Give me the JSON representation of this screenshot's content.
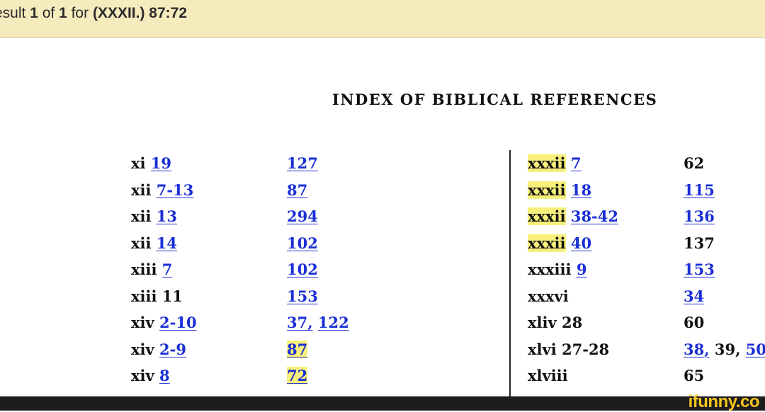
{
  "result_bar": {
    "prefix": "esult ",
    "current": "1",
    "of": " of ",
    "total": "1",
    "for": " for ",
    "query": "(XXXII.) 87:72"
  },
  "title": "INDEX OF BIBLICAL REFERENCES",
  "left_rows": [
    {
      "chapter": "xi",
      "verse": "19",
      "verse_link": true,
      "pages": [
        {
          "text": "127",
          "link": true
        }
      ]
    },
    {
      "chapter": "xii",
      "verse": "7-13",
      "verse_link": true,
      "pages": [
        {
          "text": "87",
          "link": true
        }
      ]
    },
    {
      "chapter": "xii",
      "verse": "13",
      "verse_link": true,
      "pages": [
        {
          "text": "294",
          "link": true
        }
      ]
    },
    {
      "chapter": "xii",
      "verse": "14",
      "verse_link": true,
      "pages": [
        {
          "text": "102",
          "link": true
        }
      ]
    },
    {
      "chapter": "xiii",
      "verse": "7",
      "verse_link": true,
      "pages": [
        {
          "text": "102",
          "link": true
        }
      ]
    },
    {
      "chapter": "xiii",
      "verse": "11",
      "verse_link": false,
      "pages": [
        {
          "text": "153",
          "link": true
        }
      ]
    },
    {
      "chapter": "xiv",
      "verse": "2-10",
      "verse_link": true,
      "pages": [
        {
          "text": "37,",
          "link": true
        },
        {
          "text": "122",
          "link": true
        }
      ]
    },
    {
      "chapter": "xiv",
      "verse": "2-9",
      "verse_link": true,
      "pages": [
        {
          "text": "87",
          "link": true,
          "highlight": true
        }
      ]
    },
    {
      "chapter": "xiv",
      "verse": "8",
      "verse_link": true,
      "pages": [
        {
          "text": "72",
          "link": true,
          "highlight": true
        }
      ]
    }
  ],
  "right_rows": [
    {
      "chapter": "xxxii",
      "verse": "7",
      "verse_link": true,
      "highlight": true,
      "pages": [
        {
          "text": "62",
          "link": false
        }
      ]
    },
    {
      "chapter": "xxxii",
      "verse": "18",
      "verse_link": true,
      "highlight": true,
      "pages": [
        {
          "text": "115",
          "link": true
        }
      ]
    },
    {
      "chapter": "xxxii",
      "verse": "38-42",
      "verse_link": true,
      "highlight": true,
      "pages": [
        {
          "text": "136",
          "link": true
        }
      ]
    },
    {
      "chapter": "xxxii",
      "verse": "40",
      "verse_link": true,
      "highlight": true,
      "pages": [
        {
          "text": "137",
          "link": false
        }
      ]
    },
    {
      "chapter": "xxxiii",
      "verse": "9",
      "verse_link": true,
      "highlight": false,
      "pages": [
        {
          "text": "153",
          "link": true
        }
      ]
    },
    {
      "chapter": "xxxvi",
      "verse": "",
      "verse_link": false,
      "highlight": false,
      "pages": [
        {
          "text": "34",
          "link": true
        }
      ]
    },
    {
      "chapter": "xliv",
      "verse": "28",
      "verse_link": false,
      "highlight": false,
      "pages": [
        {
          "text": "60",
          "link": false
        }
      ]
    },
    {
      "chapter": "xlvi",
      "verse": "27-28",
      "verse_link": false,
      "highlight": false,
      "pages": [
        {
          "text": "38,",
          "link": true
        },
        {
          "text": "39,",
          "link": false
        },
        {
          "text": "50",
          "link": true
        }
      ]
    },
    {
      "chapter": "xlviii",
      "verse": "",
      "verse_link": false,
      "highlight": false,
      "pages": [
        {
          "text": "65",
          "link": false
        }
      ]
    }
  ],
  "watermark": "ifunny.co",
  "colors": {
    "result_bar_bg": "#f6ebbd",
    "link": "#1a2fd6",
    "highlight": "#f7f07a",
    "watermark": "#f6c61c"
  }
}
